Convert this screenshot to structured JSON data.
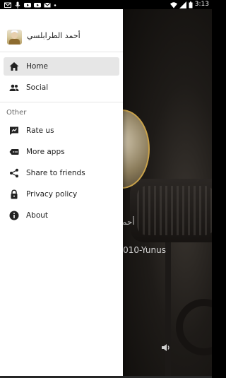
{
  "status_bar": {
    "time": "3:13",
    "left_icons": [
      "gmail-icon",
      "mic-icon",
      "youtube-icon",
      "youtube-icon",
      "mail-icon",
      "dot-icon"
    ],
    "right_icons": [
      "wifi-icon",
      "cell-signal-icon",
      "battery-icon"
    ]
  },
  "drawer": {
    "header": {
      "title": "أحمد الطرابلسي",
      "avatar_icon": "reciter-avatar"
    },
    "primary_items": [
      {
        "label": "Home",
        "icon": "home-icon",
        "active": true
      },
      {
        "label": "Social",
        "icon": "people-icon",
        "active": false
      }
    ],
    "section_title": "Other",
    "other_items": [
      {
        "label": "Rate us",
        "icon": "rate-icon"
      },
      {
        "label": "More apps",
        "icon": "more-apps-icon"
      },
      {
        "label": "Share to friends",
        "icon": "share-icon"
      },
      {
        "label": "Privacy policy",
        "icon": "lock-icon"
      },
      {
        "label": "About",
        "icon": "info-icon"
      }
    ]
  },
  "player": {
    "track_title_ar": "أحم",
    "track_title": "- 010-Yunus",
    "volume_icon": "volume-icon"
  },
  "colors": {
    "drawer_bg": "#ffffff",
    "active_item_bg": "#e6e6e6",
    "scrim": "#1e1b18",
    "cover_border": "#c9a24a"
  }
}
